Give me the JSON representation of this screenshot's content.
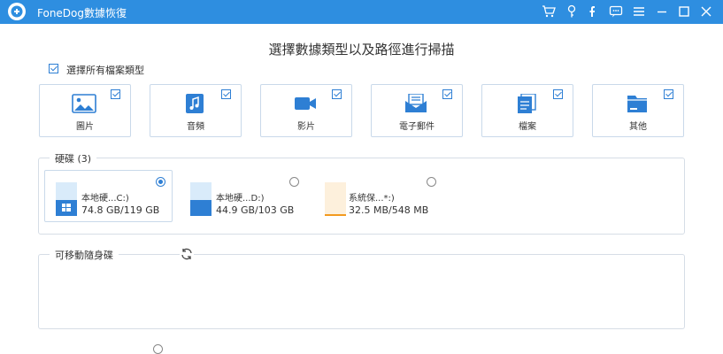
{
  "app": {
    "title": "FoneDog數據恢復",
    "brand_color": "#2e8ee0",
    "accent_color": "#2e7fd4"
  },
  "titlebar_icons": [
    "cart-icon",
    "key-icon",
    "facebook-icon",
    "chat-icon",
    "menu-icon",
    "minimize-icon",
    "maximize-icon",
    "close-icon"
  ],
  "page": {
    "title": "選擇數據類型以及路徑進行掃描",
    "select_all": {
      "label": "選擇所有檔案類型",
      "checked": true
    }
  },
  "file_types": [
    {
      "label": "圖片",
      "icon": "image-icon",
      "checked": true
    },
    {
      "label": "音頻",
      "icon": "audio-icon",
      "checked": true
    },
    {
      "label": "影片",
      "icon": "video-icon",
      "checked": true
    },
    {
      "label": "電子郵件",
      "icon": "email-icon",
      "checked": true
    },
    {
      "label": "檔案",
      "icon": "document-icon",
      "checked": true
    },
    {
      "label": "其他",
      "icon": "folder-icon",
      "checked": true
    }
  ],
  "disks": {
    "title": "硬碟 (3)",
    "drives": [
      {
        "name": "本地硬...C:)",
        "size": "74.8 GB/119 GB",
        "icon": "windows-drive-icon",
        "selected": true
      },
      {
        "name": "本地硬...D:)",
        "size": "44.9 GB/103 GB",
        "icon": "drive-icon",
        "selected": false
      },
      {
        "name": "系統保...*:)",
        "size": "32.5 MB/548 MB",
        "icon": "system-drive-icon",
        "selected": false
      }
    ]
  },
  "removable": {
    "title": "可移動隨身碟",
    "refresh_icon": "refresh-icon"
  }
}
